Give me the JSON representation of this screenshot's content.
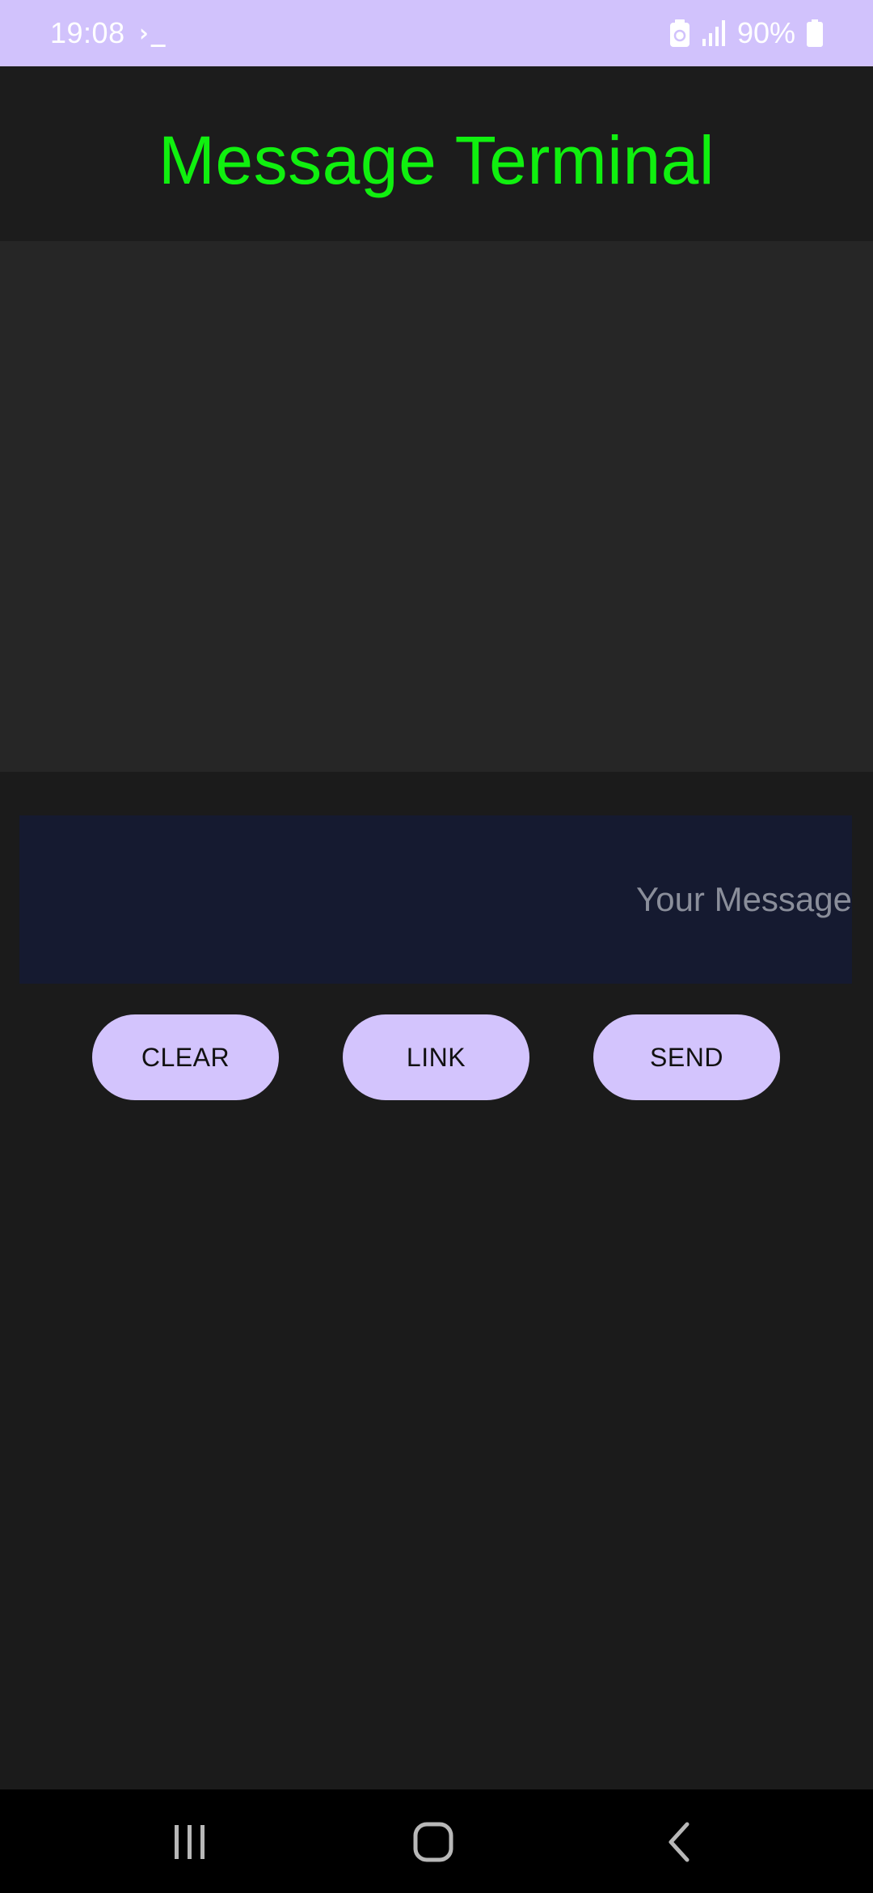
{
  "status_bar": {
    "time": "19:08",
    "terminal_glyph": "›_",
    "battery_percent": "90%",
    "icons": [
      "terminal-icon",
      "battery-saver-icon",
      "signal-icon",
      "battery-icon"
    ],
    "background_color": "#d1c2fc"
  },
  "header": {
    "title": "Message Terminal",
    "title_color": "#10f00f"
  },
  "message_log": {
    "messages": []
  },
  "input": {
    "value": "",
    "placeholder": "Your Message"
  },
  "buttons": {
    "clear_label": "CLEAR",
    "link_label": "LINK",
    "send_label": "SEND",
    "color": "#d3c4fd"
  },
  "nav_bar": {
    "icons": [
      "recents-icon",
      "home-icon",
      "back-icon"
    ]
  }
}
